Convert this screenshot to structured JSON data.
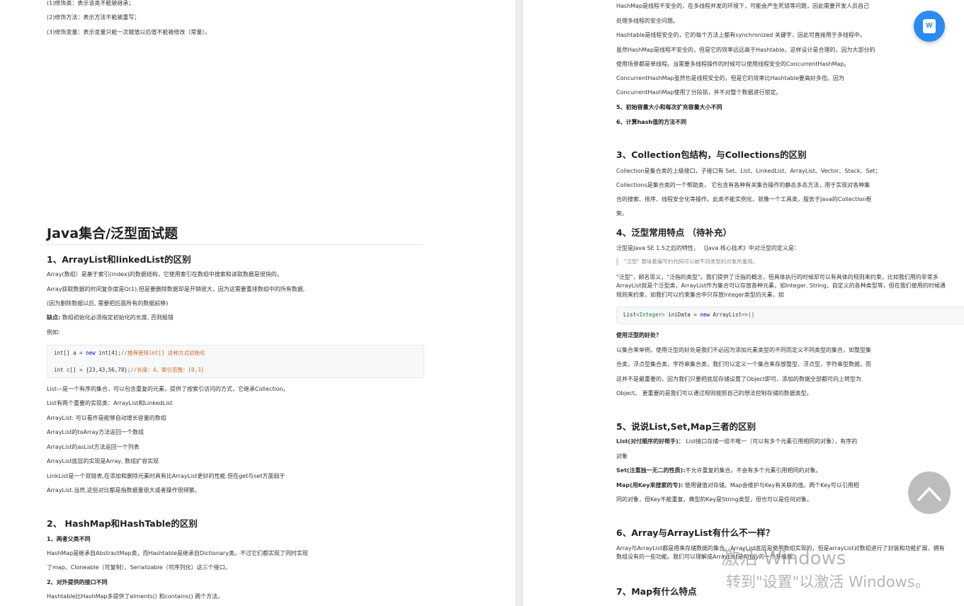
{
  "left": {
    "modifier_lines": [
      "(1)修饰类：表示该类不能被继承；",
      "(2)修饰方法：表示方法不能被重写；",
      "(3)修饰变量：表示变量只能一次赋值以后值不能被修改（常量）。"
    ],
    "section_title": "Java集合/泛型面试题",
    "q1_title": "1、ArrayList和linkedList的区别",
    "q1_p1": "Array(数组）是基于索引(index)的数据结构，它使用索引在数组中搜索和读取数据是很快的。",
    "q1_p2": "Array获取数据的时间复杂度是O(1),但是要删除数据却是开销很大，因为这需要重排数组中的所有数据,",
    "q1_p3": "(因为删除数据以后, 需要把后面所有的数据前移)",
    "q1_p4_label": "缺点:",
    "q1_p4_text": " 数组初始化必须指定初始化的长度, 否则报错",
    "q1_p5": "例如:",
    "code1": {
      "l1_a": "int[] a = ",
      "l1_b": "new",
      "l1_c": " int[4];",
      "l1_comment": "//推荐使用int[] 这种方式初始化",
      "l2_a": "int c[] = {23,43,56,78};",
      "l2_comment": "//长度：4，索引范围：[0,3]"
    },
    "list_lines": [
      "List—是一个有序的集合，可以包含重复的元素，提供了按索引访问的方式，它继承Collection。",
      "List有两个重要的实现类：ArrayList和LinkedList",
      "ArrayList: 可以看作是能够自动增长容量的数组",
      "ArrayList的toArray方法返回一个数组",
      "ArrayList的asList方法返回一个列表",
      "ArrayList底层的实现是Array, 数组扩容实现",
      "LinkList是一个双链表,在添加和删除元素时具有比ArrayList更好的性能.但在get与set方面弱于",
      "ArrayList.当然,这些对比都是指数据量很大或者操作很频繁。"
    ],
    "q2_title": "2、 HashMap和HashTable的区别",
    "q2_s1": "1、两者父类不同",
    "q2_s1_l1": "HashMap是继承自AbstractMap类，而Hashtable是继承自Dictionary类。不过它们都实现了同时实现",
    "q2_s1_l2": "了map、Cloneable（可复制）、Serializable（可序列化）这三个接口。",
    "q2_s2": "2、对外提供的接口不同",
    "q2_s2_l1": "Hashtable比HashMap多提供了elments() 和contains() 两个方法。"
  },
  "right": {
    "top_lines": [
      "HashMap是线程不安全的，在多线程并发的环境下，可能会产生死锁等问题，因此需要开发人员自己",
      "处理多线程的安全问题。",
      "Hashtable是线程安全的，它的每个方法上都有synchronized 关键字，因此可直接用于多线程中。",
      "虽然HashMap是线程不安全的，但是它的效率远远高于Hashtable，这样设计是合理的，因为大部分的",
      "使用场景都是单线程。当需要多线程操作的时候可以使用线程安全的ConcurrentHashMap。",
      "ConcurrentHashMap虽然也是线程安全的，但是它的效率比Hashtable要高好多倍。因为",
      "ConcurrentHashMap使用了分段锁，并不对整个数据进行锁定。"
    ],
    "s5": "5、初始容量大小和每次扩充容量大小不同",
    "s6": "6、计算hash值的方法不同",
    "q3_title": "3、Collection包结构，与Collections的区别",
    "q3_lines": [
      "Collection是集合类的上级接口，子接口有 Set、List、LinkedList、ArrayList、Vector、Stack、Set；",
      "Collections是集合类的一个帮助类， 它包含有各种有关集合操作的静态多态方法，用于实现对各种集",
      "合的搜索、排序、线程安全化等操作。此类不能实例化，就像一个工具类，服务于Java的Collection框",
      "架。"
    ],
    "q4_title": "4、泛型常用特点 （待补充）",
    "q4_intro": "泛型是Java SE 1.5之后的特性， 《Java 核心技术》中对泛型的定义是：",
    "q4_quote": "\"泛型\" 意味着编写的代码可以被不同类型的对象所重用。",
    "q4_p1": "\"泛型\"，顾名思义，\"泛指的类型\"。我们提供了泛指的概念，但具体执行的时候却可以有具体的规则来约束，比如我们用的非常多",
    "q4_p2": "ArrayList就是个泛型类，ArrayList作为集合可以存放各种元素，如Integer, String，自定义的各种类型等，但在我们使用的时候通",
    "q4_p3": "规则来约束，如我们可以约束集合中只存放Integer类型的元素，如",
    "code2": {
      "a": "List",
      "b": "<Integer>",
      "c": " iniData = ",
      "d": "new",
      "e": " ArrayList",
      "f": "<>()"
    },
    "benefit_title": "使用泛型的好处？",
    "benefit_lines": [
      "以集合来举例，使用泛型的好处是我们不必因为添加元素类型的不同而定义不同类型的集合，如整型集",
      "合类，浮点型集合类，字符串集合类，我们可以定义一个集合来存放整型、浮点型，字符串型数据，而",
      "这并不是最重要的，因为我们只要把底层存储设置了Object即可，添加的数据全部都可向上转型为",
      "Object。 更重要的是我们可以通过规则按照自己的想法控制存储的数据类型。"
    ],
    "q5_title": "5、说说List,Set,Map三者的区别",
    "q5_list_label": "List(对付顺序的好帮手)：",
    "q5_list_text": " List接口存储一组不唯一（可以有多个元素引用相同的对象），有序的",
    "q5_list_cont": "对象",
    "q5_set_label": "Set(注重独一无二的性质):",
    "q5_set_text": "不允许重复的集合。不会有多个元素引用相同的对象。",
    "q5_map_label": "Map(用Key来搜索的专):",
    "q5_map_text": " 使用键值对存储。Map会维护与Key有关联的值。两个Key可以引用相",
    "q5_map_cont": "同的对象，但Key不能重复，典型的Key是String类型，但也可以是任何对象。",
    "q6_title": "6、Array与ArrayList有什么不一样？",
    "q6_l1": "Array与ArrayList都是用来存储数据的集合。ArrayList底层是使用数组实现的，但是arrayList对数组进行了封装和功能扩展，拥有",
    "q6_l2": "数组没有的一些功能。我们可以理解成ArrayList是Array的一个升级版。",
    "q7_title": "7、Map有什么特点"
  },
  "wps_badge": "W",
  "watermark": {
    "line1": "激活 Windows",
    "line2": "转到\"设置\"以激活 Windows。"
  }
}
